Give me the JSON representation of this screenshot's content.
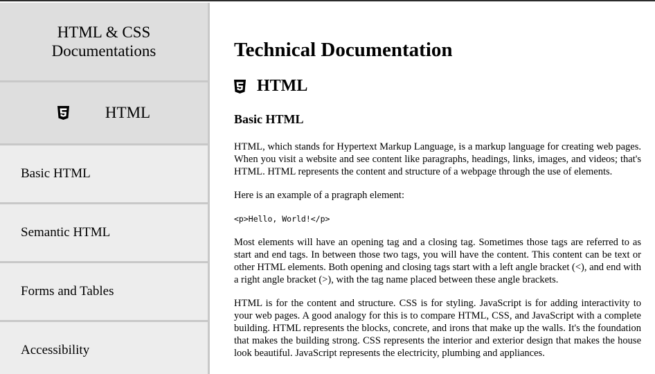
{
  "sidebar": {
    "title": "HTML & CSS\nDocumentations",
    "section": {
      "icon": "html5-icon",
      "label": "HTML"
    },
    "items": [
      {
        "label": "Basic HTML"
      },
      {
        "label": "Semantic HTML"
      },
      {
        "label": "Forms and Tables"
      },
      {
        "label": "Accessibility"
      }
    ]
  },
  "main": {
    "title": "Technical Documentation",
    "section_title": "HTML",
    "section_icon": "html5-icon",
    "subsection_title": "Basic HTML",
    "paragraphs": [
      "HTML, which stands for Hypertext Markup Language, is a markup language for creating web pages. When you visit a website and see content like paragraphs, headings, links, images, and videos; that's HTML. HTML represents the content and structure of a webpage through the use of elements.",
      "Here is an example of a pragraph element:",
      "Most elements will have an opening tag and a closing tag. Sometimes those tags are referred to as start and end tags. In between those two tags, you will have the content. This content can be text or other HTML elements. Both opening and closing tags start with a left angle bracket (<), and end with a right angle bracket (>), with the tag name placed between these angle brackets.",
      "HTML is for the content and structure. CSS is for styling. JavaScript is for adding interactivity to your web pages. A good analogy for this is to compare HTML, CSS, and JavaScript with a complete building. HTML represents the blocks, concrete, and irons that make up the walls. It's the foundation that makes the building strong. CSS represents the interior and exterior design that makes the house look beautiful. JavaScript represents the electricity, plumbing and appliances."
    ],
    "code_example": "<p>Hello, World!</p>"
  },
  "colors": {
    "sidebar_bg": "#ebebeb",
    "sidebar_header_bg": "#dedede",
    "divider": "#c8c8c8",
    "text": "#000000"
  }
}
